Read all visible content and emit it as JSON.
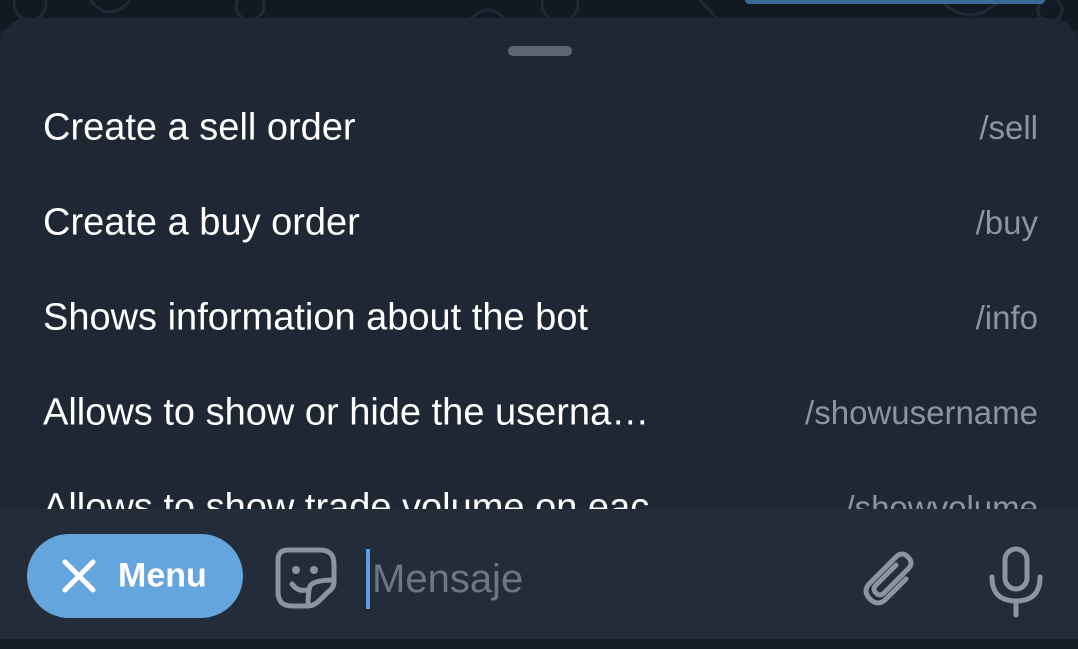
{
  "commands": [
    {
      "description": "Create a sell order",
      "command": "/sell"
    },
    {
      "description": "Create a buy order",
      "command": "/buy"
    },
    {
      "description": "Shows information about the bot",
      "command": "/info"
    },
    {
      "description": "Allows to show or hide the userna…",
      "command": "/showusername"
    },
    {
      "description": "Allows to show trade volume on eac",
      "command": "/showvolume"
    }
  ],
  "input_bar": {
    "menu_label": "Menu",
    "menu_icon": "close-icon",
    "sticker_icon": "sticker-icon",
    "message_placeholder": "Mensaje",
    "attach_icon": "paperclip-icon",
    "mic_icon": "microphone-icon"
  },
  "colors": {
    "sheet_background": "#1e2733",
    "input_bar_background": "#222d39",
    "menu_button": "#64a5dd",
    "command_text": "#ffffff",
    "command_name": "#8b949f",
    "icon_gray": "#8b949f",
    "cursor": "#5aa0e0"
  }
}
